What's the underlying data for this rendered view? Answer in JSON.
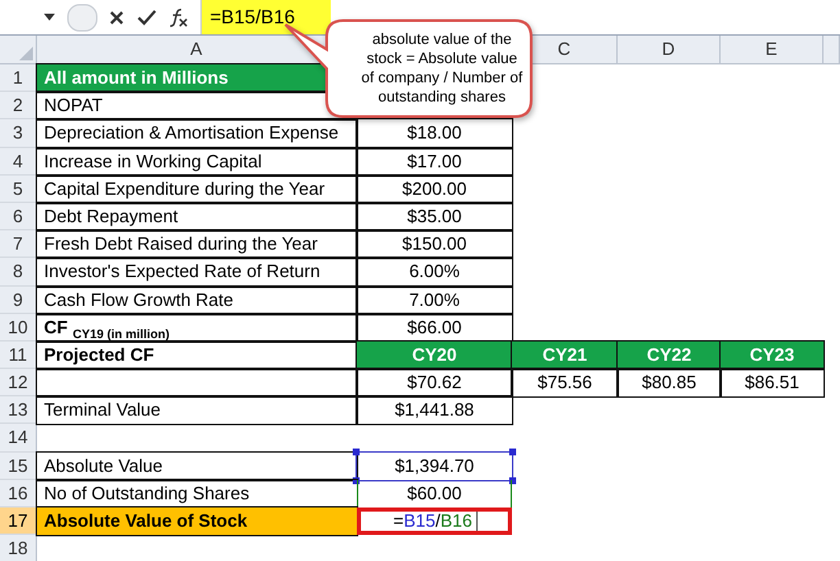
{
  "formula_bar": {
    "formula": "=B15/B16"
  },
  "callout": {
    "text": "absolute value of the stock = Absolute value of company / Number of outstanding shares"
  },
  "columns": [
    "A",
    "C",
    "D",
    "E"
  ],
  "rows": [
    {
      "label": "1",
      "selected": false,
      "cells": [
        {
          "text": "All amount in Millions",
          "kind": "header",
          "boxed": true
        }
      ]
    },
    {
      "label": "2",
      "selected": false,
      "cells": [
        {
          "text": "NOPAT",
          "kind": "plain",
          "boxed": true
        }
      ]
    },
    {
      "label": "3",
      "selected": false,
      "cells": [
        {
          "text": "Depreciation & Amortisation Expense",
          "kind": "plain",
          "boxed": true
        },
        {
          "text": "$18.00",
          "kind": "plain",
          "boxed": true
        }
      ]
    },
    {
      "label": "4",
      "selected": false,
      "cells": [
        {
          "text": "Increase in Working Capital",
          "kind": "plain",
          "boxed": true
        },
        {
          "text": "$17.00",
          "kind": "plain",
          "boxed": true
        }
      ]
    },
    {
      "label": "5",
      "selected": false,
      "cells": [
        {
          "text": "Capital Expenditure during the Year",
          "kind": "plain",
          "boxed": true
        },
        {
          "text": "$200.00",
          "kind": "plain",
          "boxed": true
        }
      ]
    },
    {
      "label": "6",
      "selected": false,
      "cells": [
        {
          "text": "Debt Repayment",
          "kind": "plain",
          "boxed": true
        },
        {
          "text": "$35.00",
          "kind": "plain",
          "boxed": true
        }
      ]
    },
    {
      "label": "7",
      "selected": false,
      "cells": [
        {
          "text": "Fresh Debt Raised during the Year",
          "kind": "plain",
          "boxed": true
        },
        {
          "text": "$150.00",
          "kind": "plain",
          "boxed": true
        }
      ]
    },
    {
      "label": "8",
      "selected": false,
      "cells": [
        {
          "text": "Investor's Expected Rate of Return",
          "kind": "plain",
          "boxed": true
        },
        {
          "text": "6.00%",
          "kind": "plain",
          "boxed": true
        }
      ]
    },
    {
      "label": "9",
      "selected": false,
      "cells": [
        {
          "text": "Cash Flow Growth Rate",
          "kind": "plain",
          "boxed": true
        },
        {
          "text": "7.00%",
          "kind": "plain",
          "boxed": true
        }
      ]
    },
    {
      "label": "10",
      "selected": false,
      "cells": [
        {
          "text": "CF $_{CY19 (in million)}$",
          "kind": "bold",
          "boxed": true
        },
        {
          "text": "$66.00",
          "kind": "plain",
          "boxed": true
        }
      ]
    },
    {
      "label": "11",
      "selected": false,
      "cells": [
        {
          "text": "Projected CF",
          "kind": "bold",
          "boxed": true
        },
        {
          "text": "CY20",
          "kind": "header",
          "boxed": true
        },
        {
          "text": "CY21",
          "kind": "header",
          "boxed": true
        },
        {
          "text": "CY22",
          "kind": "header",
          "boxed": true
        },
        {
          "text": "CY23",
          "kind": "header",
          "boxed": true
        }
      ]
    },
    {
      "label": "12",
      "selected": false,
      "cells": [
        {
          "kind": "plain",
          "boxed": true
        },
        {
          "text": "$70.62",
          "kind": "plain",
          "boxed": true
        },
        {
          "text": "$75.56",
          "kind": "plain",
          "boxed": true
        },
        {
          "text": "$80.85",
          "kind": "plain",
          "boxed": true
        },
        {
          "text": "$86.51",
          "kind": "plain",
          "boxed": true
        }
      ]
    },
    {
      "label": "13",
      "selected": false,
      "cells": [
        {
          "text": "Terminal Value",
          "kind": "plain",
          "boxed": true
        },
        {
          "text": "$1,441.88",
          "kind": "plain",
          "boxed": true
        }
      ]
    },
    {
      "label": "14",
      "selected": false,
      "cells": []
    },
    {
      "label": "15",
      "selected": false,
      "cells": [
        {
          "text": "Absolute Value",
          "kind": "plain",
          "boxed": true
        },
        {
          "text": "$1,394.70",
          "kind": "range1",
          "boxed": false
        }
      ]
    },
    {
      "label": "16",
      "selected": false,
      "cells": [
        {
          "text": "No of Outstanding Shares",
          "kind": "plain",
          "boxed": true
        },
        {
          "text": "$60.00",
          "kind": "range2",
          "boxed": false
        }
      ]
    },
    {
      "label": "17",
      "selected": true,
      "cells": [
        {
          "text": "Absolute Value of Stock",
          "kind": "total",
          "boxed": true
        },
        {
          "kind": "edit",
          "boxed": false,
          "parts": [
            {
              "text": "=",
              "kind": "plain"
            },
            {
              "text": "B15",
              "kind": "ref1"
            },
            {
              "text": "/",
              "kind": "plain"
            },
            {
              "text": "B16",
              "kind": "ref2"
            }
          ]
        }
      ]
    },
    {
      "label": "18",
      "selected": false,
      "cells": []
    }
  ]
}
